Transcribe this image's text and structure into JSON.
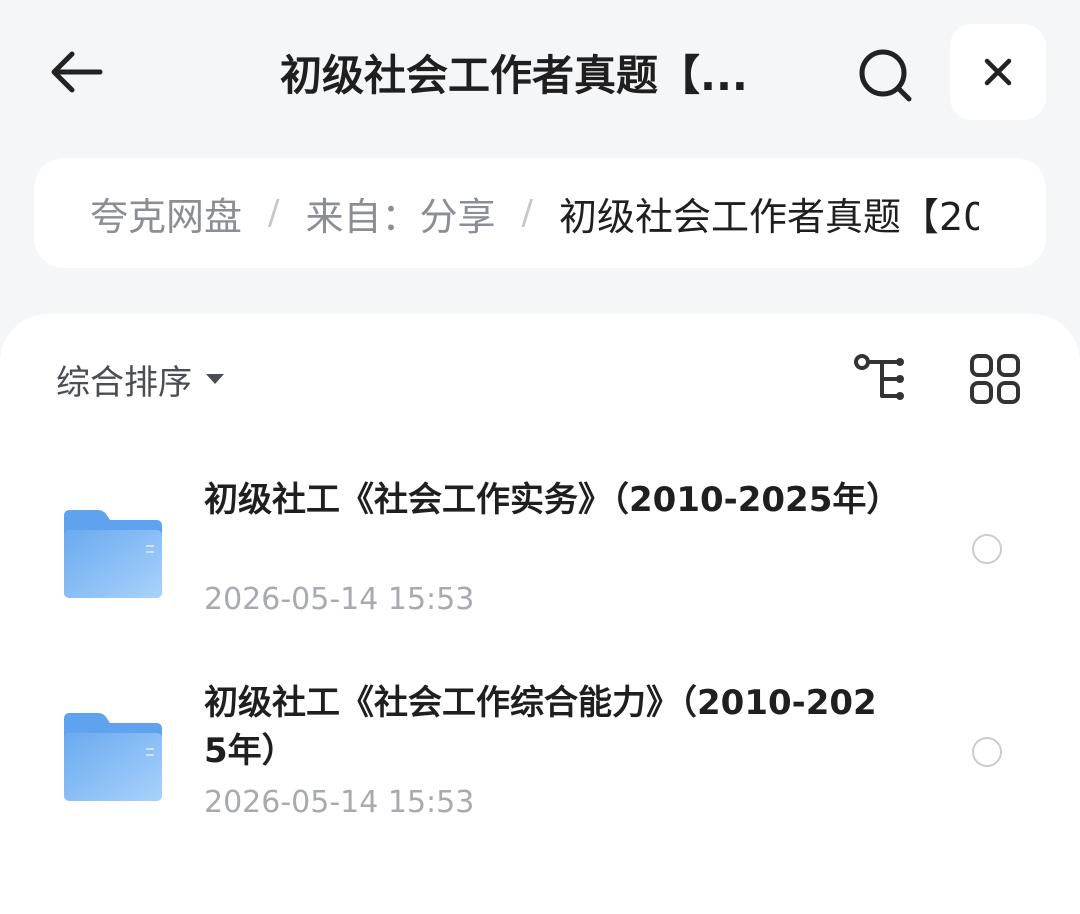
{
  "header": {
    "title": "初级社会工作者真题【...",
    "back_icon": "arrow-left-icon",
    "search_icon": "search-icon",
    "close_icon": "close-icon"
  },
  "breadcrumb": {
    "items": [
      "夸克网盘",
      "来自：分享",
      "初级社会工作者真题【20"
    ],
    "separator": "/"
  },
  "toolbar": {
    "sort_label": "综合排序",
    "sort_icon": "caret-down-icon",
    "tree_icon": "tree-view-icon",
    "grid_icon": "grid-view-icon"
  },
  "files": [
    {
      "name": "初级社工《社会工作实务》（2010-2025年）",
      "date": "2026-05-14 15:53",
      "icon": "folder-icon",
      "selected": false
    },
    {
      "name": "初级社工《社会工作综合能力》（2010-2025年）",
      "date": "2026-05-14 15:53",
      "icon": "folder-icon",
      "selected": false
    }
  ],
  "colors": {
    "background": "#f5f6f8",
    "card": "#ffffff",
    "folder": "#7fb8f2",
    "muted_text": "#a7aab0"
  }
}
